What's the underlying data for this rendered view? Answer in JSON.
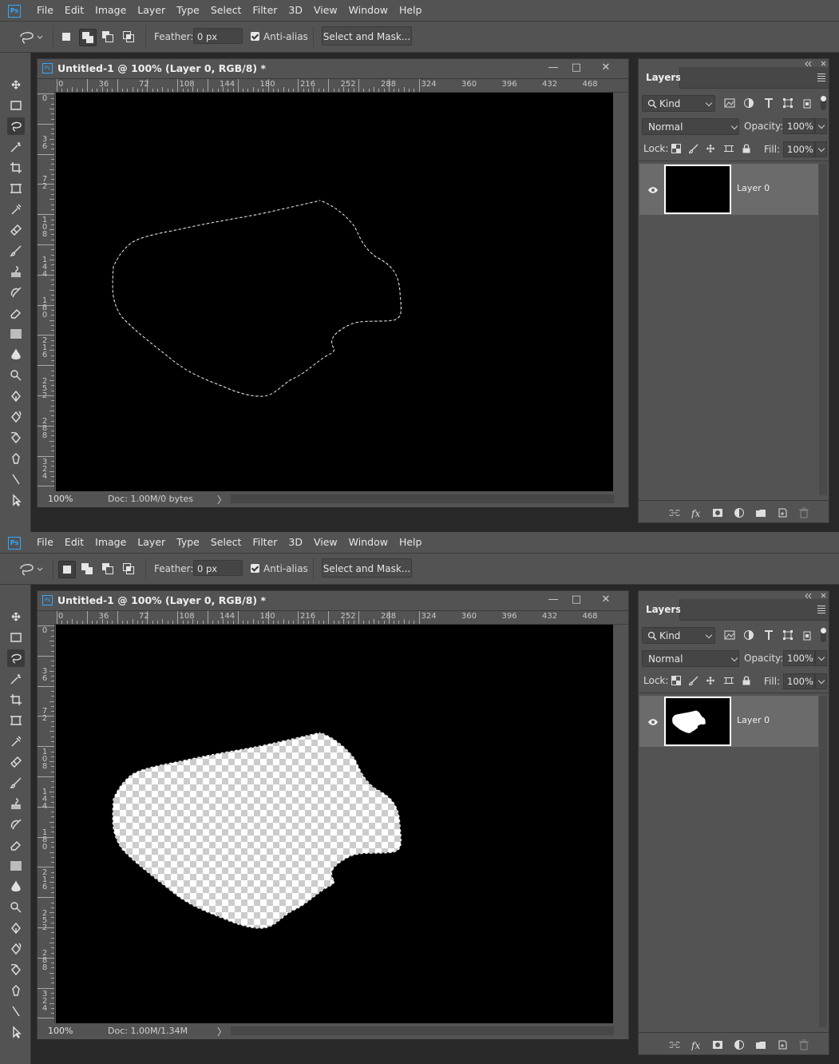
{
  "menu": [
    "File",
    "Edit",
    "Image",
    "Layer",
    "Type",
    "Select",
    "Filter",
    "3D",
    "View",
    "Window",
    "Help"
  ],
  "app_logo": "Ps",
  "options": {
    "feather_label": "Feather:",
    "feather_value": "0 px",
    "antialias_label": "Anti-alias",
    "antialias_checked": true,
    "select_mask_label": "Select and Mask..."
  },
  "document": {
    "title": "Untitled-1 @ 100% (Layer 0, RGB/8) *",
    "zoom": "100%",
    "ruler_h": [
      "0",
      "36",
      "72",
      "108",
      "144",
      "180",
      "216",
      "252",
      "288",
      "324",
      "360",
      "396",
      "432",
      "468"
    ],
    "ruler_v": [
      "0",
      "36",
      "72",
      "108",
      "144",
      "180",
      "216",
      "252",
      "288",
      "324"
    ]
  },
  "layers_panel": {
    "tab": "Layers",
    "kind_label": "Kind",
    "blend_mode": "Normal",
    "opacity_label": "Opacity:",
    "opacity_value": "100%",
    "lock_label": "Lock:",
    "fill_label": "Fill:",
    "fill_value": "100%",
    "layer_name": "Layer 0"
  },
  "states": [
    {
      "doc_info": "Doc: 1.00M/0 bytes",
      "selection_filled": false,
      "selection_mode": "add"
    },
    {
      "doc_info": "Doc: 1.00M/1.34M",
      "selection_filled": true,
      "selection_mode": "new"
    }
  ],
  "colors": {
    "chrome": "#535353",
    "workspace": "#282828",
    "canvas": "#000000",
    "accent": "#31a8ff",
    "layer_selected": "#6b6b6b"
  },
  "icons": [
    "move-icon",
    "marquee-icon",
    "lasso-icon",
    "magic-wand-icon",
    "crop-icon",
    "frame-icon",
    "eyedropper-icon",
    "healing-brush-icon",
    "brush-icon",
    "clone-stamp-icon",
    "history-brush-icon",
    "eraser-icon",
    "gradient-icon",
    "blur-icon",
    "dodge-icon",
    "pen-icon",
    "freeform-pen-icon",
    "curvature-pen-icon",
    "anchor-point-icon",
    "path-selection-icon",
    "direct-selection-icon"
  ]
}
